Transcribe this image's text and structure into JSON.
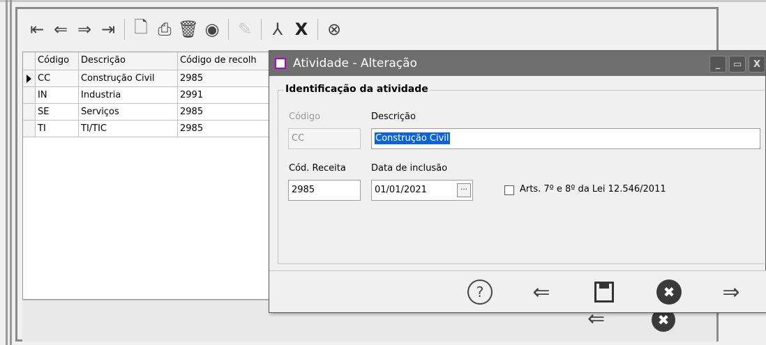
{
  "toolbar": {
    "buttons": [
      {
        "name": "first-record",
        "glyph": "⇤"
      },
      {
        "name": "previous-record",
        "glyph": "⇐"
      },
      {
        "name": "next-record",
        "glyph": "⇒"
      },
      {
        "name": "last-record",
        "glyph": "⇥"
      },
      {
        "name": "new-document",
        "glyph": "🗋"
      },
      {
        "name": "print",
        "glyph": "⎙"
      },
      {
        "name": "delete",
        "glyph": "🗑"
      },
      {
        "name": "view",
        "glyph": "◉"
      },
      {
        "name": "edit",
        "glyph": "✎"
      },
      {
        "name": "pdf-export",
        "glyph": "⅄"
      },
      {
        "name": "excel-export",
        "glyph": "X"
      },
      {
        "name": "cancel",
        "glyph": "⊗"
      }
    ]
  },
  "grid": {
    "headers": {
      "code": "Código",
      "description": "Descrição",
      "recolh": "Código de recolh"
    },
    "rows": [
      {
        "code": "CC",
        "description": "Construção Civil",
        "recolh": "2985"
      },
      {
        "code": "IN",
        "description": "Industria",
        "recolh": "2991"
      },
      {
        "code": "SE",
        "description": "Serviços",
        "recolh": "2985"
      },
      {
        "code": "TI",
        "description": "TI/TIC",
        "recolh": "2985"
      }
    ]
  },
  "dialog": {
    "title": "Atividade - Alteração",
    "group_title": "Identificação da atividade",
    "codigo_label": "Código",
    "codigo_value": "CC",
    "descricao_label": "Descrição",
    "descricao_value": "Construção Civil",
    "cod_receita_label": "Cód. Receita",
    "cod_receita_value": "2985",
    "data_inclusao_label": "Data de inclusão",
    "data_inclusao_value": "01/01/2021",
    "date_button_glyph": "···",
    "checkbox_label": "Arts. 7º e 8º da Lei 12.546/2011",
    "checkbox_checked": false,
    "footer": {
      "help": "?",
      "prev": "⇐",
      "next": "⇒",
      "cancel": "✖"
    },
    "window_buttons": {
      "minimize": "_",
      "maximize": "▭",
      "close": "X"
    }
  },
  "background_footer": {
    "prev": "⇐",
    "cancel": "✖"
  }
}
